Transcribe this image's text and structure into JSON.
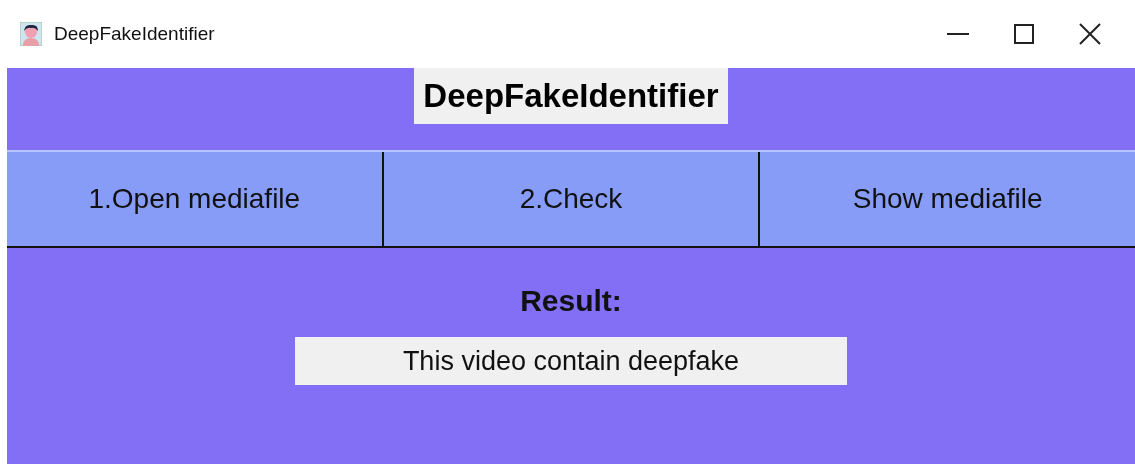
{
  "window": {
    "title": "DeepFakeIdentifier"
  },
  "header": {
    "title": "DeepFakeIdentifier"
  },
  "buttons": [
    "1.Open mediafile",
    "2.Check",
    "Show mediafile"
  ],
  "result": {
    "label": "Result:",
    "value": "This video contain deepfake"
  }
}
